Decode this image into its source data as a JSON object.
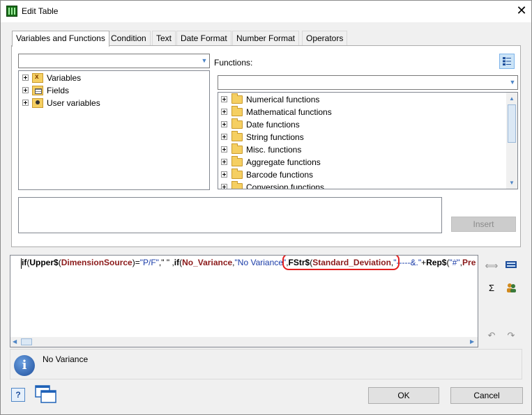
{
  "window": {
    "title": "Edit Table",
    "close_icon": "close-icon"
  },
  "tabs": [
    {
      "label": "Variables and Functions",
      "active": true
    },
    {
      "label": "Condition"
    },
    {
      "label": "Text"
    },
    {
      "label": "Date Format"
    },
    {
      "label": "Number Format"
    },
    {
      "label": "Operators"
    }
  ],
  "left_panel": {
    "combo_value": "",
    "tree": [
      {
        "label": "Variables",
        "icon": "variables-folder-icon"
      },
      {
        "label": "Fields",
        "icon": "fields-folder-icon"
      },
      {
        "label": "User variables",
        "icon": "user-variables-folder-icon"
      }
    ]
  },
  "functions_panel": {
    "label": "Functions:",
    "combo_value": "",
    "items": [
      {
        "label": "Numerical functions"
      },
      {
        "label": "Mathematical functions"
      },
      {
        "label": "Date functions"
      },
      {
        "label": "String functions"
      },
      {
        "label": "Misc. functions"
      },
      {
        "label": "Aggregate functions"
      },
      {
        "label": "Barcode functions"
      },
      {
        "label": "Conversion functions"
      }
    ]
  },
  "description_box": {
    "text": ""
  },
  "insert_button": {
    "label": "Insert",
    "enabled": false
  },
  "editor": {
    "parts": [
      {
        "text": "if",
        "style": "fn"
      },
      {
        "text": "(",
        "style": "plain"
      },
      {
        "text": "Upper$",
        "style": "fn"
      },
      {
        "text": "(",
        "style": "plain"
      },
      {
        "text": "DimensionSource",
        "style": "var"
      },
      {
        "text": ")=",
        "style": "plain"
      },
      {
        "text": "\"P/F\"",
        "style": "str"
      },
      {
        "text": ",\" \" ,",
        "style": "plain"
      },
      {
        "text": "if",
        "style": "fn"
      },
      {
        "text": "(",
        "style": "plain"
      },
      {
        "text": "No_Variance",
        "style": "var"
      },
      {
        "text": ",",
        "style": "plain"
      },
      {
        "text": "\"No Variance\"",
        "style": "str"
      },
      {
        "text": ",",
        "style": "plain"
      },
      {
        "text": "FStr$",
        "style": "fn"
      },
      {
        "text": "(",
        "style": "plain"
      },
      {
        "text": "Standard_Deviation",
        "style": "var"
      },
      {
        "text": ",",
        "style": "plain"
      },
      {
        "text": "\"-----&.\"",
        "style": "str"
      },
      {
        "text": "+",
        "style": "plain"
      },
      {
        "text": "Rep$",
        "style": "fn"
      },
      {
        "text": "(",
        "style": "plain"
      },
      {
        "text": "\"#\"",
        "style": "str"
      },
      {
        "text": ",",
        "style": "plain"
      },
      {
        "text": "Pre",
        "style": "var"
      }
    ]
  },
  "side_tools": {
    "icons": [
      "wrap-icon",
      "field-box-icon",
      "sum-icon",
      "user-variables-icon",
      "undo-icon",
      "redo-icon"
    ],
    "sum_label": "Σ",
    "undo_label": "↶",
    "redo_label": "↷"
  },
  "info": {
    "icon_label": "i",
    "text": "No Variance"
  },
  "footer": {
    "help_label": "?",
    "ok_label": "OK",
    "cancel_label": "Cancel"
  },
  "colors": {
    "accent": "#4f86c6",
    "highlight_ring": "#e31e1e",
    "variable": "#8b1a1a",
    "string": "#1a3ca8"
  }
}
